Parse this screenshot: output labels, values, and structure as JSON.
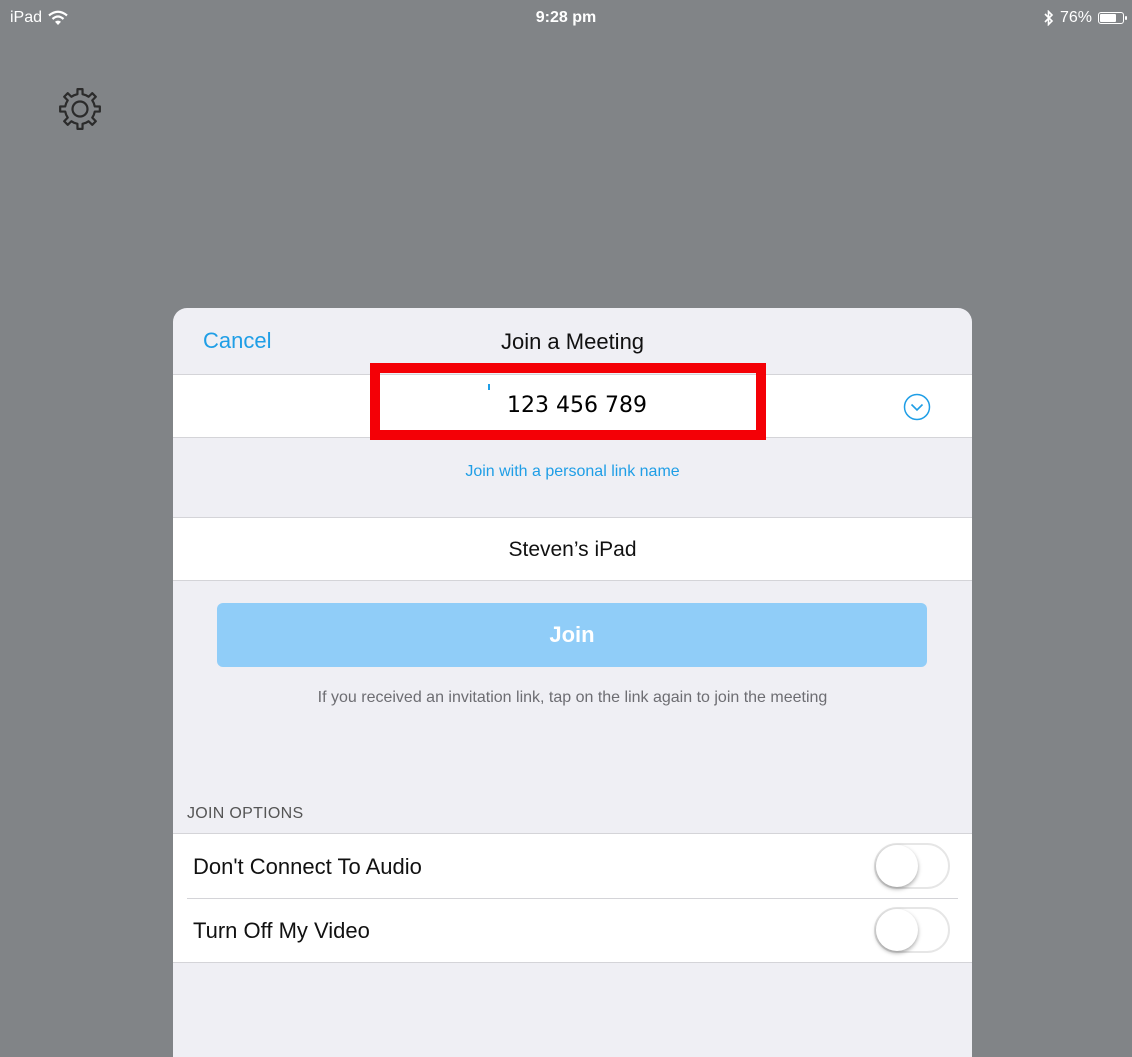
{
  "status_bar": {
    "device": "iPad",
    "time": "9:28 pm",
    "battery": "76%",
    "battery_level": 0.76
  },
  "modal": {
    "cancel_label": "Cancel",
    "title": "Join a Meeting",
    "meeting_id": "123 456 789",
    "personal_link_label": "Join with a personal link name",
    "display_name": "Steven’s iPad",
    "join_label": "Join",
    "hint": "If you received an invitation link, tap on the link again to join the meeting",
    "join_options": {
      "header": "JOIN OPTIONS",
      "items": [
        {
          "label": "Don't Connect To Audio",
          "on": false
        },
        {
          "label": "Turn Off My Video",
          "on": false
        }
      ]
    }
  },
  "colors": {
    "background": "#818487",
    "accent": "#1f9ee6",
    "join_button": "#90cdf8",
    "highlight": "#f40006"
  },
  "icons": [
    "wifi-icon",
    "gear-icon",
    "bluetooth-icon",
    "battery-icon",
    "chevron-down-circle-icon"
  ]
}
